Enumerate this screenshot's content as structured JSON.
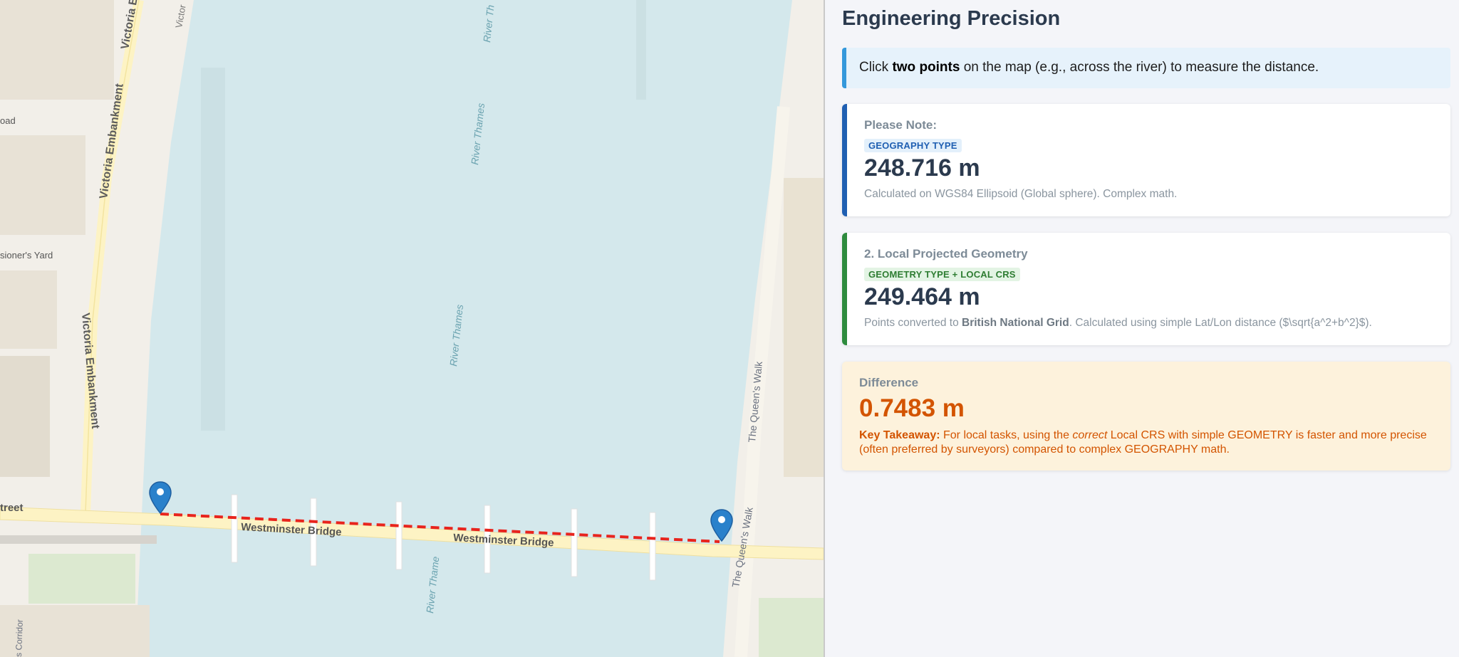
{
  "map": {
    "labels": {
      "victoria_embankment_1": "Victoria Embankment",
      "victoria_embankment_2": "Victoria Embankment",
      "victoria_top": "Victoria E",
      "victor_top": "Victor",
      "road": "oad",
      "yard": "sioner's Yard",
      "street": "treet",
      "river_thames_1": "River Th",
      "river_thames_2": "River Thames",
      "river_thames_3": "River Thames",
      "river_thames_4": "River Thame",
      "westminster_bridge_1": "Westminster Bridge",
      "westminster_bridge_2": "Westminster Bridge",
      "queens_walk_1": "The Queen's Walk",
      "queens_walk_2": "The Queen's Walk",
      "queens_walk_3": "The Queen's Walk",
      "corridor": "s Corridor"
    },
    "colors": {
      "water": "#d4e8ec",
      "land": "#f2efe9",
      "road": "#fdf3c4",
      "measure_line": "#e8241d",
      "marker": "#2a81cb"
    }
  },
  "panel": {
    "title": "Engineering Precision",
    "info": {
      "prefix": "Click ",
      "bold": "two points",
      "suffix": " on the map (e.g., across the river) to measure the distance."
    },
    "geography_card": {
      "label": "Please Note:",
      "badge": "GEOGRAPHY TYPE",
      "value": "248.716 m",
      "description": "Calculated on WGS84 Ellipsoid (Global sphere). Complex math."
    },
    "geometry_card": {
      "label": "2. Local Projected Geometry",
      "badge": "GEOMETRY TYPE + LOCAL CRS",
      "value": "249.464 m",
      "desc_prefix": "Points converted to ",
      "desc_bold": "British National Grid",
      "desc_suffix": ". Calculated using simple Lat/Lon distance ($\\sqrt{a^2+b^2}$)."
    },
    "difference_card": {
      "label": "Difference",
      "value": "0.7483 m",
      "takeaway_bold": "Key Takeaway:",
      "takeaway_pre": " For local tasks, using the ",
      "takeaway_italic": "correct",
      "takeaway_post": " Local CRS with simple GEOMETRY is faster and more precise (often preferred by surveyors) compared to complex GEOGRAPHY math."
    }
  }
}
